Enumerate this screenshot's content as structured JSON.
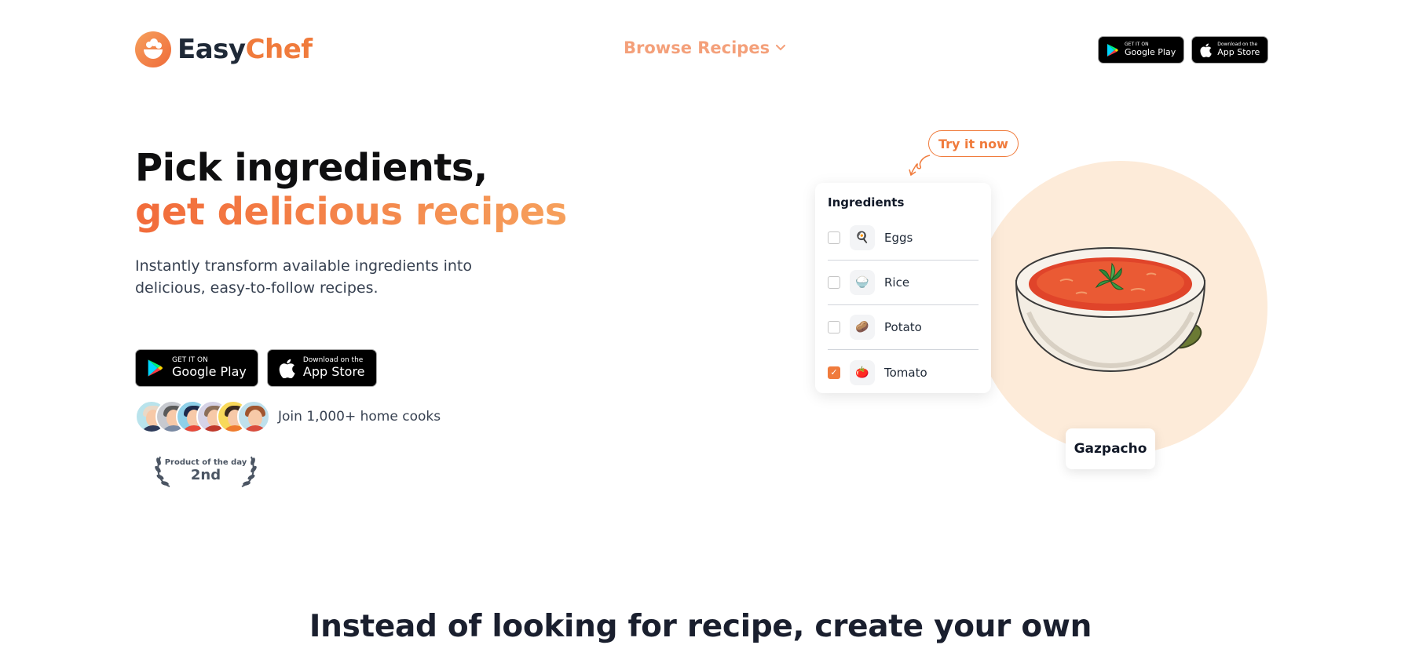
{
  "header": {
    "logo": {
      "part1": "Easy",
      "part2": "Chef"
    },
    "nav": {
      "browse_label": "Browse Recipes"
    },
    "badges": {
      "google": {
        "top": "GET IT ON",
        "main": "Google Play"
      },
      "apple": {
        "top": "Download on the",
        "main": "App Store"
      }
    }
  },
  "hero": {
    "title_line1": "Pick ingredients,",
    "title_line2": "get delicious recipes",
    "subtitle": "Instantly transform available ingredients into delicious, easy-to-follow recipes.",
    "badges": {
      "google": {
        "top": "GET IT ON",
        "main": "Google Play"
      },
      "apple": {
        "top": "Download on the",
        "main": "App Store"
      }
    },
    "social_proof": "Join 1,000+ home cooks",
    "product_of_day": {
      "label": "Product of the day",
      "rank": "2nd"
    }
  },
  "demo": {
    "try_label": "Try it now",
    "card_title": "Ingredients",
    "ingredients": [
      {
        "label": "Eggs",
        "checked": false,
        "icon": "egg-icon"
      },
      {
        "label": "Rice",
        "checked": false,
        "icon": "rice-icon"
      },
      {
        "label": "Potato",
        "checked": false,
        "icon": "potato-icon"
      },
      {
        "label": "Tomato",
        "checked": true,
        "icon": "tomato-icon"
      }
    ],
    "dish_name": "Gazpacho"
  },
  "section": {
    "title": "Instead of looking for recipe, create your own"
  },
  "colors": {
    "accent": "#f07b3c",
    "nav_text": "#f4a07a",
    "circle_bg": "#fdebd9"
  }
}
